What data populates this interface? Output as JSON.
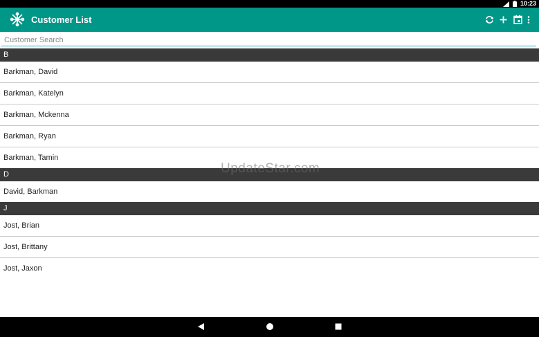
{
  "status_bar": {
    "time": "10:23"
  },
  "app_bar": {
    "title": "Customer List",
    "actions": [
      "refresh-icon",
      "add-icon",
      "calendar-icon",
      "overflow-menu-icon"
    ]
  },
  "search": {
    "placeholder": "Customer Search",
    "value": ""
  },
  "sections": [
    {
      "letter": "B",
      "customers": [
        "Barkman, David",
        "Barkman, Katelyn",
        "Barkman, Mckenna",
        "Barkman, Ryan",
        "Barkman, Tamin"
      ]
    },
    {
      "letter": "D",
      "customers": [
        "David, Barkman"
      ]
    },
    {
      "letter": "J",
      "customers": [
        "Jost, Brian",
        "Jost, Brittany",
        "Jost, Jaxon"
      ]
    }
  ],
  "watermark": "UpdateStar.com",
  "nav_bar": {
    "buttons": [
      "back-icon",
      "home-icon",
      "recents-icon"
    ]
  },
  "colors": {
    "app_bar": "#009688",
    "section_header": "#3a3a3a",
    "search_underline": "#21a9c0"
  }
}
